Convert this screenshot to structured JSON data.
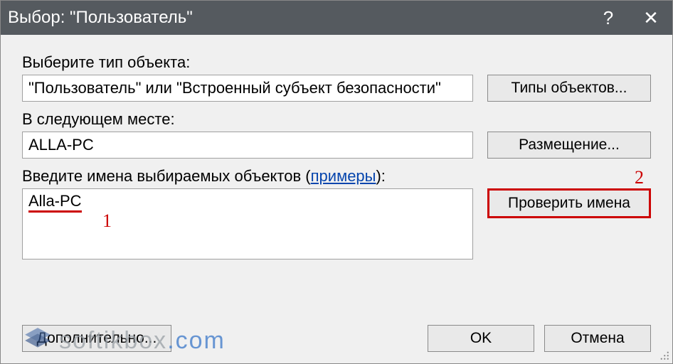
{
  "titlebar": {
    "title": "Выбор: \"Пользователь\""
  },
  "section_type": {
    "label": "Выберите тип объекта:",
    "value": "\"Пользователь\" или \"Встроенный субъект безопасности\"",
    "button": "Типы объектов..."
  },
  "section_location": {
    "label": "В следующем месте:",
    "value": "ALLA-PC",
    "button": "Размещение..."
  },
  "section_names": {
    "label_prefix": "Введите имена выбираемых объектов (",
    "examples_link": "примеры",
    "label_suffix": "):",
    "value": "Alla-PC",
    "button": "Проверить имена"
  },
  "annotations": {
    "one": "1",
    "two": "2"
  },
  "footer": {
    "advanced": "Дополнительно...",
    "ok": "OK",
    "cancel": "Отмена"
  },
  "watermark": {
    "name": "softikbox",
    "tld": ".com"
  }
}
